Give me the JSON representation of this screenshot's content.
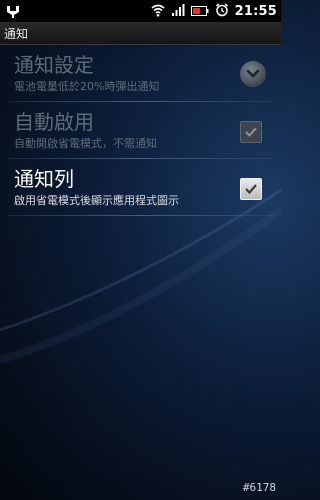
{
  "status_bar": {
    "time": "21:55",
    "icons": [
      "usb-debug-icon",
      "wifi-icon",
      "signal-icon",
      "battery-icon",
      "alarm-clock-icon"
    ]
  },
  "titlebar": {
    "title": "通知"
  },
  "settings": [
    {
      "title": "通知設定",
      "summary": "電池電量低於20%時彈出通知",
      "control": "dropdown",
      "enabled": false
    },
    {
      "title": "自動啟用",
      "summary": "自動開啟省電模式，不需通知",
      "control": "checkbox",
      "checked": true,
      "enabled": false
    },
    {
      "title": "通知列",
      "summary": "啟用省電模式後顯示應用程式圖示",
      "control": "checkbox",
      "checked": true,
      "enabled": true
    }
  ],
  "watermark": "#6178",
  "colors": {
    "background": "#0c1d38",
    "status_bar": "#000000",
    "dim_text": "#5e6b7a",
    "active_text": "#ffffff"
  }
}
